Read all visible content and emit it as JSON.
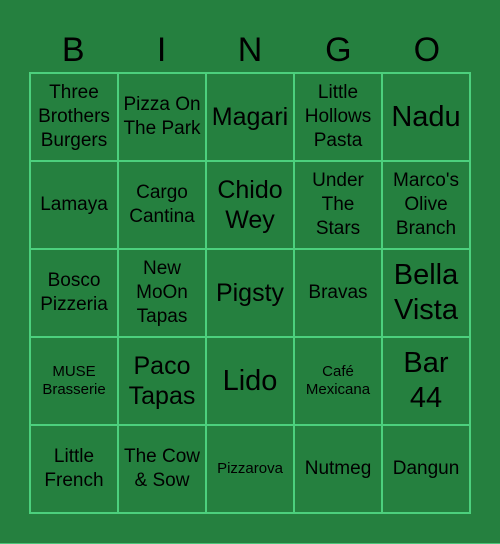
{
  "header": [
    "B",
    "I",
    "N",
    "G",
    "O"
  ],
  "colors": {
    "background": "#25803f",
    "grid_line": "#4cd07d",
    "text": "#000000"
  },
  "cells": [
    [
      "Three Brothers Burgers",
      "Pizza On The Park",
      "Magari",
      "Little Hollows Pasta",
      "Nadu"
    ],
    [
      "Lamaya",
      "Cargo Cantina",
      "Chido Wey",
      "Under The Stars",
      "Marco's Olive Branch"
    ],
    [
      "Bosco Pizzeria",
      "New MoOn Tapas",
      "Pigsty",
      "Bravas",
      "Bella Vista"
    ],
    [
      "MUSE Brasserie",
      "Paco Tapas",
      "Lido",
      "Café Mexicana",
      "Bar 44"
    ],
    [
      "Little French",
      "The Cow & Sow",
      "Pizzarova",
      "Nutmeg",
      "Dangun"
    ]
  ]
}
